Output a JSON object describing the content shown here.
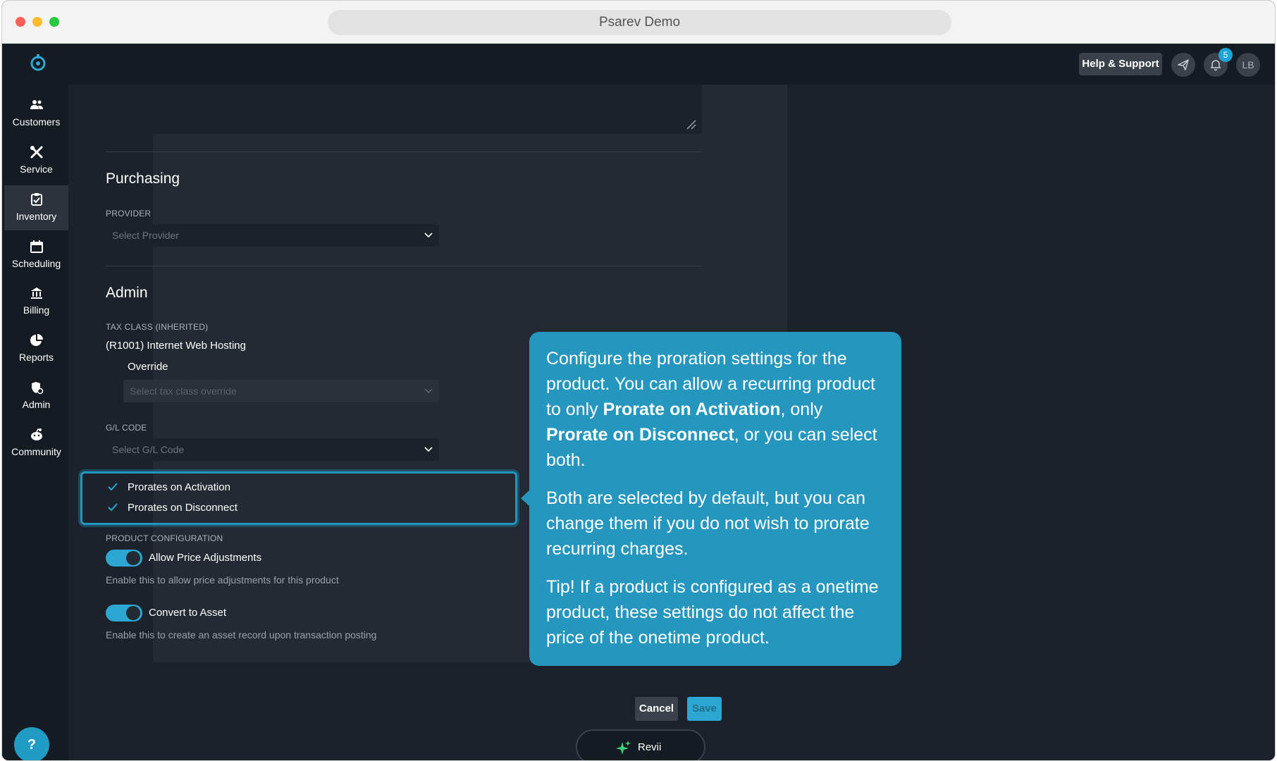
{
  "window": {
    "title": "Psarev Demo"
  },
  "topbar": {
    "help_label": "Help & Support",
    "notification_count": "5",
    "avatar_initials": "LB"
  },
  "sidebar": {
    "items": [
      {
        "label": "Customers",
        "icon": "customers-icon"
      },
      {
        "label": "Service",
        "icon": "service-icon"
      },
      {
        "label": "Inventory",
        "icon": "inventory-icon",
        "active": true
      },
      {
        "label": "Scheduling",
        "icon": "calendar-icon"
      },
      {
        "label": "Billing",
        "icon": "bank-icon"
      },
      {
        "label": "Reports",
        "icon": "pie-chart-icon"
      },
      {
        "label": "Admin",
        "icon": "admin-icon"
      },
      {
        "label": "Community",
        "icon": "community-icon"
      }
    ],
    "help_fab": "?"
  },
  "purchasing": {
    "title": "Purchasing",
    "provider_label": "PROVIDER",
    "provider_placeholder": "Select Provider"
  },
  "admin": {
    "title": "Admin",
    "tax_class_label": "TAX CLASS (INHERITED)",
    "tax_class_value": "(R1001) Internet Web Hosting",
    "override_label": "Override",
    "override_checked": false,
    "tax_override_placeholder": "Select tax class override",
    "gl_code_label": "G/L CODE",
    "gl_code_placeholder": "Select G/L Code",
    "prorates_activation_label": "Prorates on Activation",
    "prorates_activation_checked": true,
    "prorates_disconnect_label": "Prorates on Disconnect",
    "prorates_disconnect_checked": true
  },
  "product_config": {
    "label": "PRODUCT CONFIGURATION",
    "allow_price_label": "Allow Price Adjustments",
    "allow_price_on": true,
    "allow_price_help": "Enable this to allow price adjustments for this product",
    "convert_asset_label": "Convert to Asset",
    "convert_asset_on": true,
    "convert_asset_help": "Enable this to create an asset record upon transaction posting"
  },
  "actions": {
    "cancel_label": "Cancel",
    "save_label": "Save",
    "revii_label": "Revii"
  },
  "tooltip": {
    "p1_a": "Configure the proration settings for the product. You can allow a recurring product to only ",
    "p1_b": "Prorate on Activation",
    "p1_c": ", only ",
    "p1_d": "Prorate on Disconnect",
    "p1_e": ", or you can select both.",
    "p2": "Both are selected by default, but you can change them if you do not wish to prorate recurring charges.",
    "p3": "Tip! If a product is configured as a onetime product, these settings do not affect the price of the onetime product."
  },
  "colors": {
    "accent": "#2ca7d3",
    "tooltip_bg": "#2596be",
    "sidebar_bg": "#151b22",
    "content_bg": "#1b222b"
  }
}
